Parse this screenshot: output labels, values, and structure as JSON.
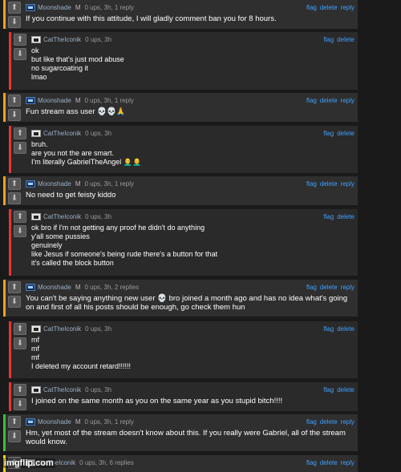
{
  "accent_colors": {
    "orange": "#f0a020",
    "red": "#e53535",
    "green": "#3bbf3b",
    "yellow": "#f2d21b",
    "link": "#3da0ff"
  },
  "icons": {
    "upvote": "arrow-up-icon",
    "downvote": "arrow-down-icon",
    "user_moonshade": "moonshade-avatar-icon",
    "user_cat": "cat-avatar-icon"
  },
  "comments": [
    {
      "user": "Moonshade",
      "mod": "M",
      "stats": "0 ups, 3h, 1 reply",
      "actions": [
        "flag",
        "delete",
        "reply"
      ],
      "text": "If you continue with this attitude, I will gladly comment ban you for 8 hours."
    },
    {
      "user": "CatTheIconik",
      "stats": "0 ups, 3h",
      "actions": [
        "flag",
        "delete"
      ],
      "text": "ok\nbut like that's just mod abuse\nno sugarcoating it\nlmao"
    },
    {
      "user": "Moonshade",
      "mod": "M",
      "stats": "0 ups, 3h, 1 reply",
      "actions": [
        "flag",
        "delete",
        "reply"
      ],
      "text": "Fun stream ass user 💀💀🙏"
    },
    {
      "user": "CatTheIconik",
      "stats": "0 ups, 3h",
      "actions": [
        "flag",
        "delete"
      ],
      "text": "bruh.\nare you not the are smart.\nI'm literally GabrielTheAngel 👨‍🦲👨‍🦲"
    },
    {
      "user": "Moonshade",
      "mod": "M",
      "stats": "0 ups, 3h, 1 reply",
      "actions": [
        "flag",
        "delete",
        "reply"
      ],
      "text": "No need to get feisty kiddo"
    },
    {
      "user": "CatTheIconik",
      "stats": "0 ups, 3h",
      "actions": [
        "flag",
        "delete"
      ],
      "text": "ok bro if I'm not getting any proof he didn't do anything\ny'all some pussies\ngenuinely\nlike Jesus if someone's being rude there's a button for that\nit's called the block button"
    },
    {
      "user": "Moonshade",
      "mod": "M",
      "stats": "0 ups, 3h, 2 replies",
      "actions": [
        "flag",
        "delete",
        "reply"
      ],
      "text": "You can't be saying anything new user 💀 bro joined a month ago and has no idea what's going on and first of all his posts should be enough, go check them hun"
    },
    {
      "user": "CatTheIconik",
      "stats": "0 ups, 3h",
      "actions": [
        "flag",
        "delete"
      ],
      "text": "mf\nmf\nmf\nI deleted my account retard!!!!!!"
    },
    {
      "user": "CatTheIconik",
      "stats": "0 ups, 3h",
      "actions": [
        "flag",
        "delete"
      ],
      "text": "I joined on the same month as you on the same year as you stupid bitch!!!!"
    },
    {
      "user": "Moonshade",
      "mod": "M",
      "stats": "0 ups, 3h, 1 reply",
      "actions": [
        "flag",
        "delete",
        "reply"
      ],
      "text": "Hm, yet most of the stream doesn't know about this. If you really were Gabriel, all of the stream would know."
    },
    {
      "user": "CatTheIconik",
      "stats": "0 ups, 3h, 6 replies",
      "actions": [
        "flag",
        "delete",
        "reply"
      ],
      "text": ""
    }
  ],
  "watermark": "imgflip.com"
}
